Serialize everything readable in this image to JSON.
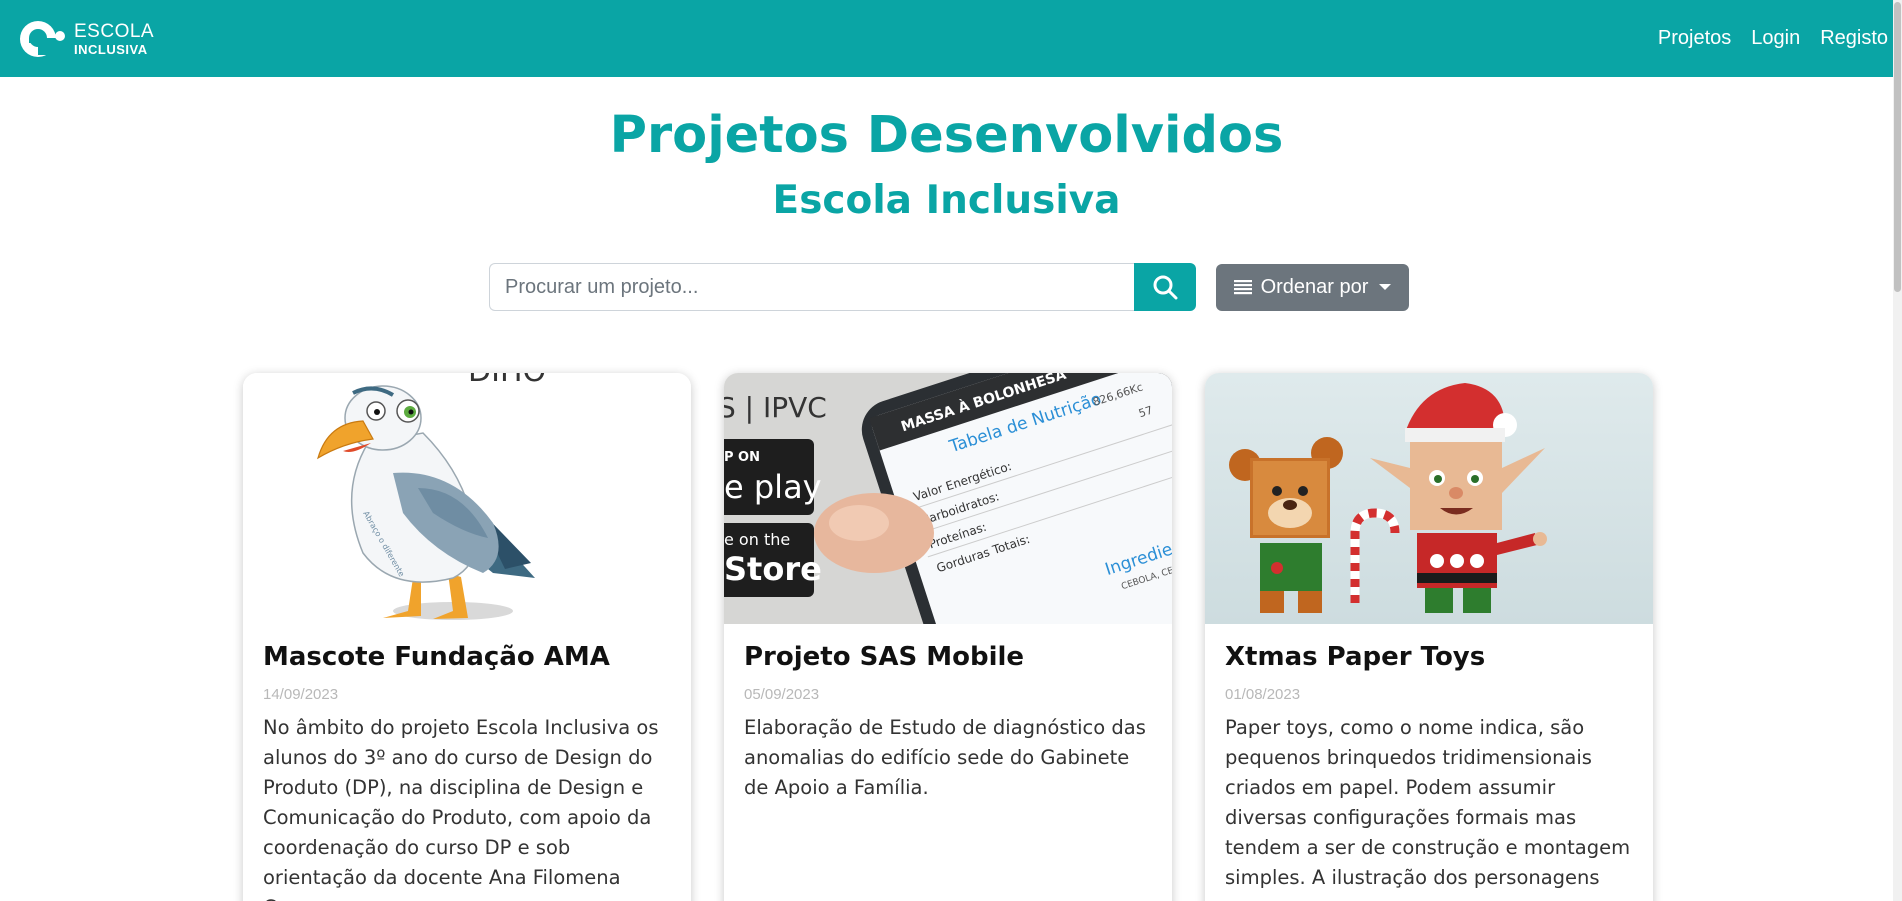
{
  "brand": {
    "line1": "ESCOLA",
    "line2": "INCLUSIVA",
    "accent_color": "#0aa5a5"
  },
  "nav": {
    "links": [
      "Projetos",
      "Login",
      "Registo"
    ]
  },
  "page": {
    "title": "Projetos Desenvolvidos",
    "subtitle": "Escola Inclusiva"
  },
  "search": {
    "placeholder": "Procurar um projeto...",
    "value": "",
    "button_icon": "search-icon"
  },
  "sort": {
    "label": "Ordenar por",
    "icon": "list-icon"
  },
  "cards": [
    {
      "title": "Mascote Fundação AMA",
      "date": "14/09/2023",
      "description": "No âmbito do projeto Escola Inclusiva os alunos do 3º ano do curso de Design do Produto (DP), na disciplina de Design e Comunicação do Produto, com apoio da coordenação do curso DP e sob orientação da docente Ana Filomena Cur...",
      "image_labels": {
        "top": "DIHO",
        "wing": "Abraço o diferente"
      }
    },
    {
      "title": "Projeto SAS Mobile",
      "date": "05/09/2023",
      "description": "Elaboração de Estudo de diagnóstico das anomalias do edifício sede do Gabinete de Apoio a Família.",
      "image_labels": {
        "brand": "S | IPVC",
        "store1_small": "P ON",
        "store1_big": "e play",
        "store2_small": "e on the",
        "store2_big": "Store",
        "phone_header": "MASSA À BOLONHESA",
        "table_title": "Tabela de Nutrição",
        "row1": "Valor Energético:",
        "row1_val": "826,66Kc",
        "row2": "Carboidratos:",
        "row2_val": "57",
        "row3": "Proteínas:",
        "row4": "Gorduras Totais:",
        "ingredients": "Ingredientes",
        "ingredients_list": "CEBOLA, CENOURA"
      }
    },
    {
      "title": "Xtmas Paper Toys",
      "date": "01/08/2023",
      "description": "Paper toys, como o nome indica, são pequenos brinquedos tridimensionais criados em papel. Podem assumir diversas configurações formais mas tendem a ser de construção e montagem simples. A ilustração dos personagens expressa a..."
    }
  ]
}
